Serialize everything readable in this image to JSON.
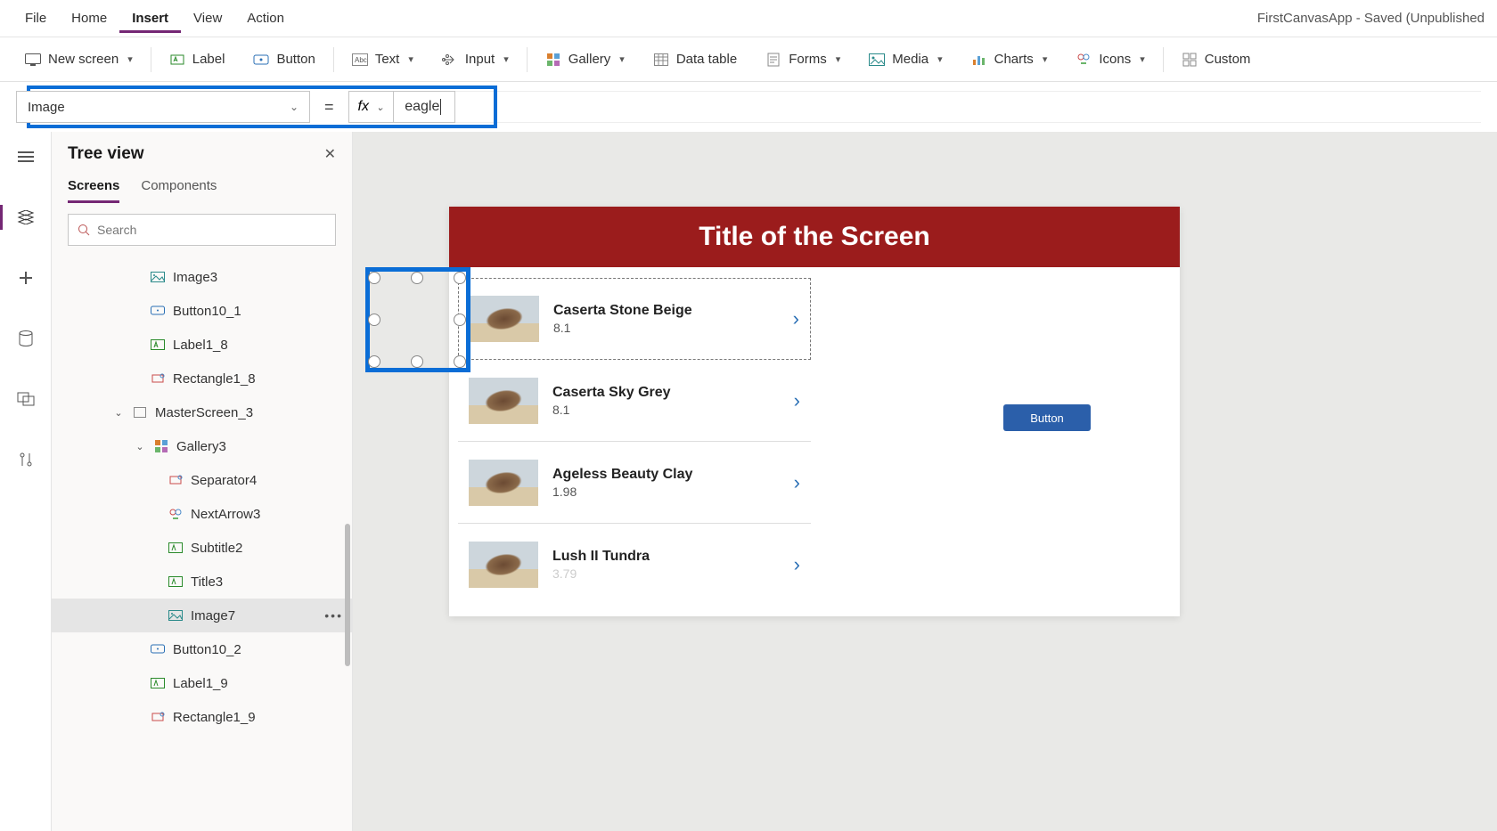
{
  "app_title": "FirstCanvasApp - Saved (Unpublished",
  "menu": {
    "file": "File",
    "home": "Home",
    "insert": "Insert",
    "view": "View",
    "action": "Action"
  },
  "ribbon": {
    "new_screen": "New screen",
    "label": "Label",
    "button": "Button",
    "text": "Text",
    "input": "Input",
    "gallery": "Gallery",
    "datatable": "Data table",
    "forms": "Forms",
    "media": "Media",
    "charts": "Charts",
    "icons": "Icons",
    "custom": "Custom"
  },
  "formula": {
    "property": "Image",
    "equals": "=",
    "fx": "fx",
    "value": "eagle"
  },
  "tree": {
    "title": "Tree view",
    "tab_screens": "Screens",
    "tab_components": "Components",
    "search_placeholder": "Search",
    "items": {
      "image3": "Image3",
      "button10_1": "Button10_1",
      "label1_8": "Label1_8",
      "rectangle1_8": "Rectangle1_8",
      "masterscreen3": "MasterScreen_3",
      "gallery3": "Gallery3",
      "separator4": "Separator4",
      "nextarrow3": "NextArrow3",
      "subtitle2": "Subtitle2",
      "title3": "Title3",
      "image7": "Image7",
      "button10_2": "Button10_2",
      "label1_9": "Label1_9",
      "rectangle1_9": "Rectangle1_9"
    }
  },
  "canvas": {
    "screen_title": "Title of the Screen",
    "button_label": "Button",
    "rows": [
      {
        "title": "Caserta Stone Beige",
        "sub": "8.1"
      },
      {
        "title": "Caserta Sky Grey",
        "sub": "8.1"
      },
      {
        "title": "Ageless Beauty Clay",
        "sub": "1.98"
      },
      {
        "title": "Lush II Tundra",
        "sub": "3.79"
      }
    ]
  }
}
